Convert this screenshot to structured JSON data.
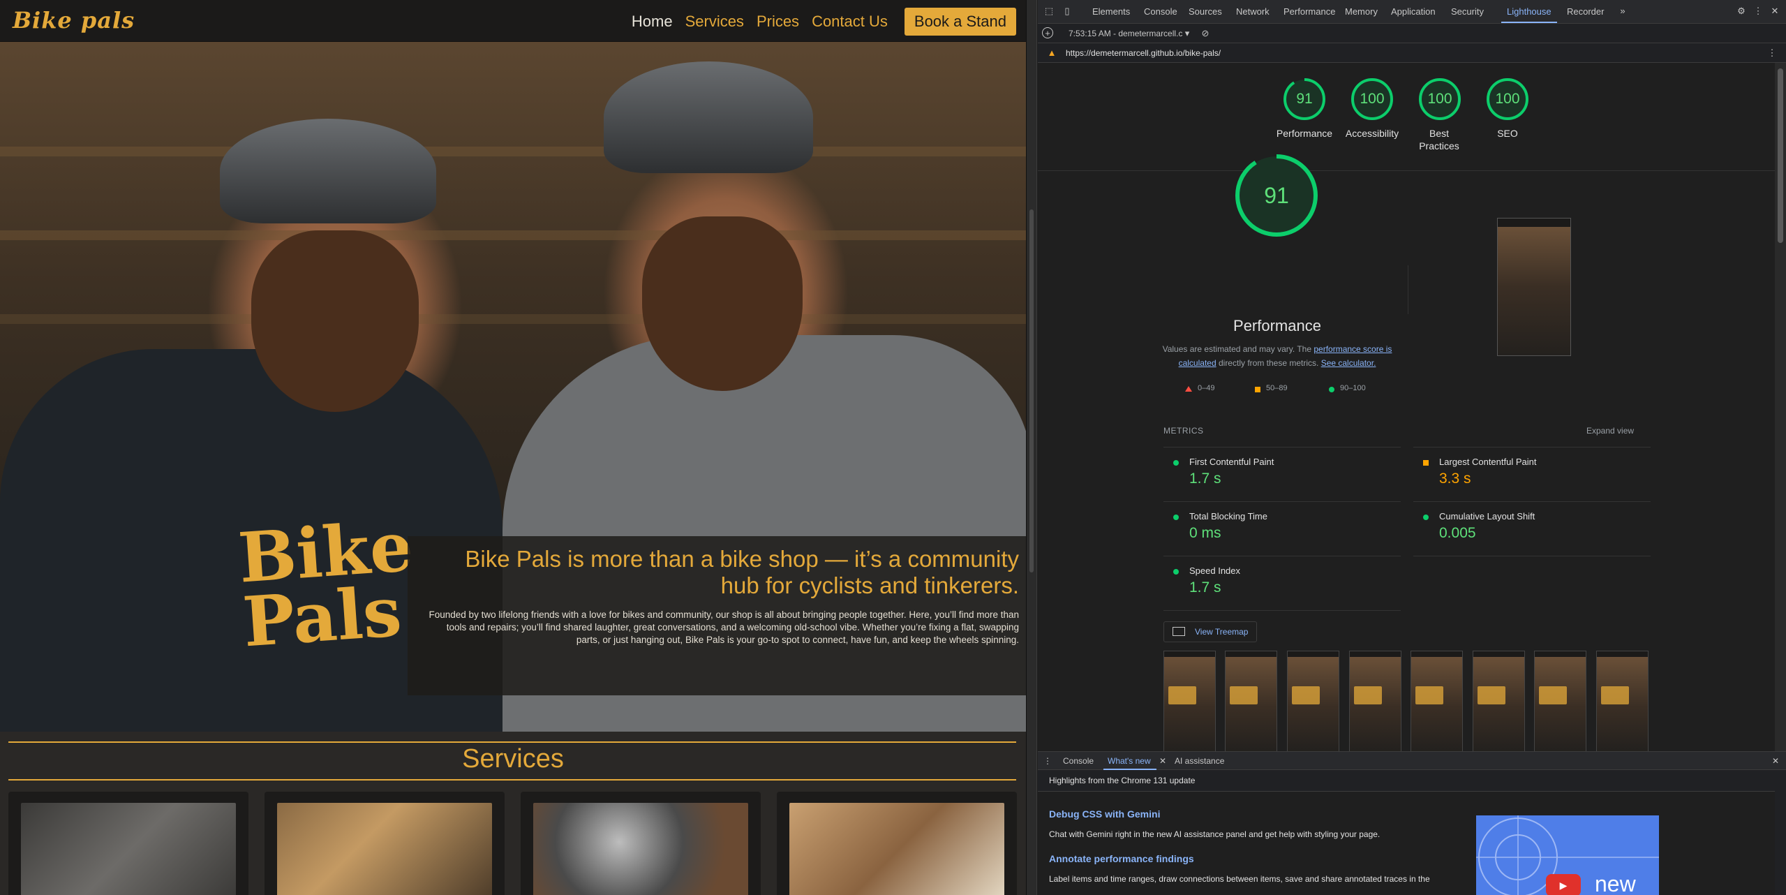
{
  "site": {
    "logo": "Bike pals",
    "nav": {
      "home": "Home",
      "services": "Services",
      "prices": "Prices",
      "contact": "Contact Us",
      "cta": "Book a Stand"
    },
    "hero": {
      "shirt_logo_line1": "Bike",
      "shirt_logo_line2": "Pals",
      "title": "Bike Pals is more than a bike shop — it’s a community hub for cyclists and tinkerers.",
      "text": "Founded by two lifelong friends with a love for bikes and community, our shop is all about bringing people together. Here, you’ll find more than tools and repairs; you’ll find shared laughter, great conversations, and a welcoming old-school vibe. Whether you’re fixing a flat, swapping parts, or just hanging out, Bike Pals is your go-to spot to connect, have fun, and keep the wheels spinning."
    },
    "services_title": "Services",
    "accent": "#e4a93a"
  },
  "devtools": {
    "tabs": [
      "Elements",
      "Console",
      "Sources",
      "Network",
      "Performance",
      "Memory",
      "Application",
      "Security",
      "Lighthouse",
      "Recorder"
    ],
    "active_tab": "Lighthouse",
    "report_time": "7:53:15 AM - demetermarcell.c",
    "url": "https://demetermarcell.github.io/bike-pals/",
    "scores": [
      {
        "label": "Performance",
        "score": "91"
      },
      {
        "label": "Accessibility",
        "score": "100"
      },
      {
        "label": "Best Practices",
        "score": "100"
      },
      {
        "label": "SEO",
        "score": "100"
      }
    ],
    "performance": {
      "score": "91",
      "title": "Performance",
      "note_prefix": "Values are estimated and may vary. The ",
      "note_link1": "performance score is calculated",
      "note_mid": " directly from these metrics. ",
      "note_link2": "See calculator.",
      "legend": {
        "low": "0–49",
        "mid": "50–89",
        "high": "90–100"
      }
    },
    "metrics_header": "METRICS",
    "expand_view": "Expand view",
    "metrics": [
      {
        "label": "First Contentful Paint",
        "value": "1.7 s",
        "status": "good"
      },
      {
        "label": "Largest Contentful Paint",
        "value": "3.3 s",
        "status": "average"
      },
      {
        "label": "Total Blocking Time",
        "value": "0 ms",
        "status": "good"
      },
      {
        "label": "Cumulative Layout Shift",
        "value": "0.005",
        "status": "good"
      },
      {
        "label": "Speed Index",
        "value": "1.7 s",
        "status": "good"
      }
    ],
    "treemap_button": "View Treemap",
    "colors": {
      "good": "#0cce6b",
      "average": "#ffa400",
      "fail": "#ff4e42",
      "link": "#8ab4f8"
    }
  },
  "drawer": {
    "tabs": [
      "Console",
      "What's new",
      "AI assistance"
    ],
    "active_tab": "What's new",
    "header": "Highlights from the Chrome 131 update",
    "items": [
      {
        "title": "Debug CSS with Gemini",
        "text": "Chat with Gemini right in the new AI assistance panel and get help with styling your page."
      },
      {
        "title": "Annotate performance findings",
        "text": "Label items and time ranges, draw connections between items, save and share annotated traces in the"
      }
    ],
    "video_label": "new"
  }
}
